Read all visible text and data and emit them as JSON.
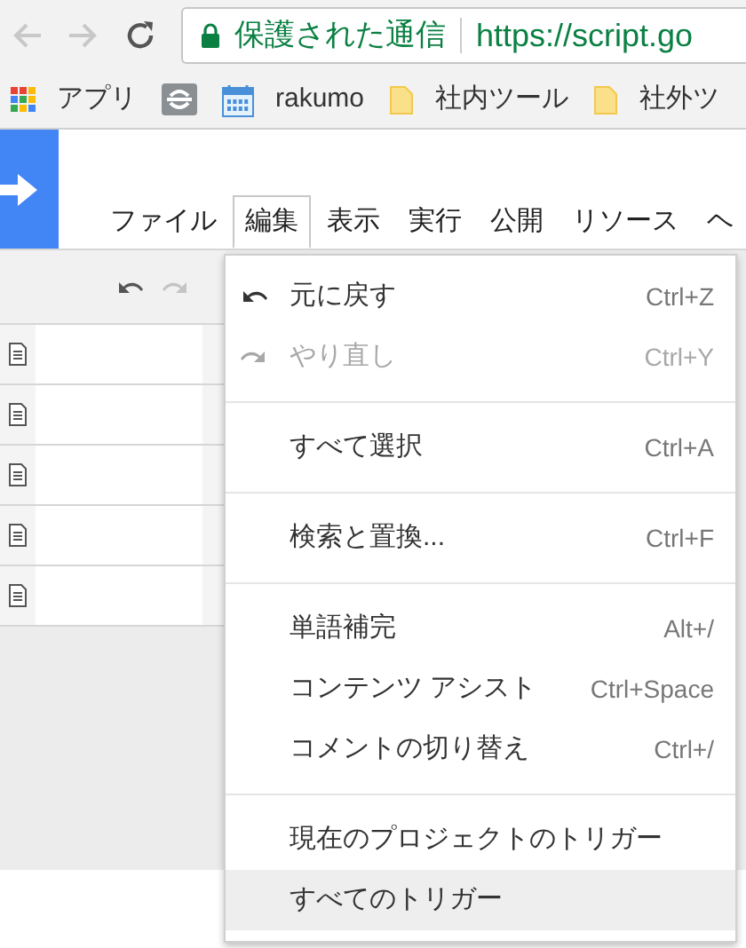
{
  "browser": {
    "security": "保護された通信",
    "url": "https://script.go"
  },
  "bookmarks": [
    {
      "kind": "apps",
      "label": "アプリ"
    },
    {
      "kind": "site"
    },
    {
      "kind": "calendar",
      "label": "rakumo"
    },
    {
      "kind": "folder",
      "label": "社内ツール"
    },
    {
      "kind": "folder",
      "label": "社外ツ"
    }
  ],
  "menubar": [
    {
      "label": "ファイル",
      "selected": false
    },
    {
      "label": "編集",
      "selected": true
    },
    {
      "label": "表示",
      "selected": false
    },
    {
      "label": "実行",
      "selected": false
    },
    {
      "label": "公開",
      "selected": false
    },
    {
      "label": "リソース",
      "selected": false
    },
    {
      "label": "ヘ",
      "selected": false
    }
  ],
  "file_rows": [
    {
      "kind": "file"
    },
    {
      "kind": "file"
    },
    {
      "kind": "file"
    },
    {
      "kind": "file"
    },
    {
      "kind": "file"
    }
  ],
  "menu": [
    {
      "kind": "undo",
      "label": "元に戻す",
      "shortcut": "Ctrl+Z",
      "disabled": false,
      "selected": false
    },
    {
      "kind": "redo",
      "label": "やり直し",
      "shortcut": "Ctrl+Y",
      "disabled": true,
      "selected": false
    },
    {
      "kind": "divider"
    },
    {
      "kind": "item",
      "label": "すべて選択",
      "shortcut": "Ctrl+A",
      "disabled": false,
      "selected": false
    },
    {
      "kind": "divider"
    },
    {
      "kind": "item",
      "label": "検索と置換...",
      "shortcut": "Ctrl+F",
      "disabled": false,
      "selected": false
    },
    {
      "kind": "divider"
    },
    {
      "kind": "item",
      "label": "単語補完",
      "shortcut": "Alt+/",
      "disabled": false,
      "selected": false
    },
    {
      "kind": "item",
      "label": "コンテンツ アシスト",
      "shortcut": "Ctrl+Space",
      "disabled": false,
      "selected": false
    },
    {
      "kind": "item",
      "label": "コメントの切り替え",
      "shortcut": "Ctrl+/",
      "disabled": false,
      "selected": false
    },
    {
      "kind": "divider"
    },
    {
      "kind": "item",
      "label": "現在のプロジェクトのトリガー",
      "disabled": false,
      "selected": false
    },
    {
      "kind": "item",
      "label": "すべてのトリガー",
      "disabled": false,
      "selected": true
    }
  ]
}
